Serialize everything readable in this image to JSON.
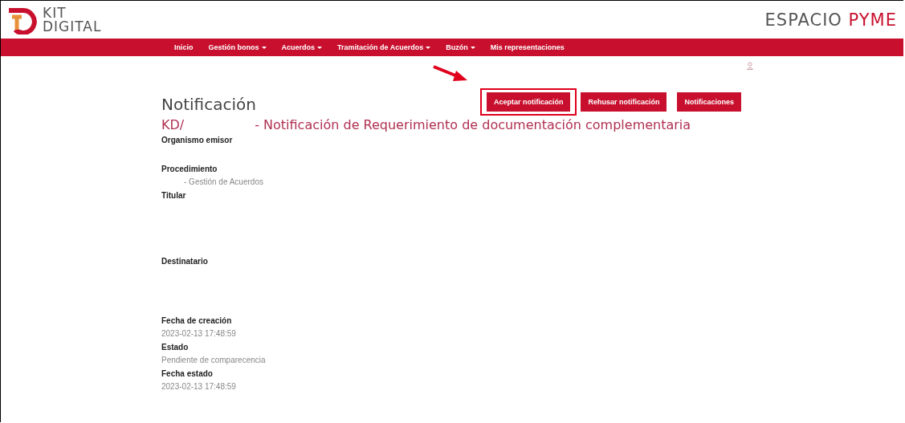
{
  "header": {
    "logo_line1": "KIT",
    "logo_line2": "DIGITAL",
    "brand_part1": "ESPACIO",
    "brand_part2": "PYME"
  },
  "nav": [
    {
      "label": "Inicio",
      "dropdown": false
    },
    {
      "label": "Gestión bonos",
      "dropdown": true
    },
    {
      "label": "Acuerdos",
      "dropdown": true
    },
    {
      "label": "Tramitación de Acuerdos",
      "dropdown": true
    },
    {
      "label": "Buzón",
      "dropdown": true
    },
    {
      "label": "Mis representaciones",
      "dropdown": false
    }
  ],
  "page": {
    "title": "Notificación",
    "ref": "KD/",
    "subject": "- Notificación de Requerimiento de documentación complementaria"
  },
  "buttons": [
    {
      "label": "Aceptar notificación",
      "highlighted": true
    },
    {
      "label": "Rehusar notificación",
      "highlighted": false
    },
    {
      "label": "Notificaciones",
      "highlighted": false
    }
  ],
  "fields": [
    {
      "label": "Organismo emisor"
    },
    {
      "label": "Procedimiento",
      "value": "- Gestión de Acuerdos"
    },
    {
      "label": "Titular"
    },
    {
      "label": "Destinatario"
    },
    {
      "label": "Fecha de creación",
      "value": "2023-02-13 17:48:59"
    },
    {
      "label": "Estado",
      "value": "Pendiente de comparecencia"
    },
    {
      "label": "Fecha estado",
      "value": "2023-02-13 17:48:59"
    }
  ]
}
